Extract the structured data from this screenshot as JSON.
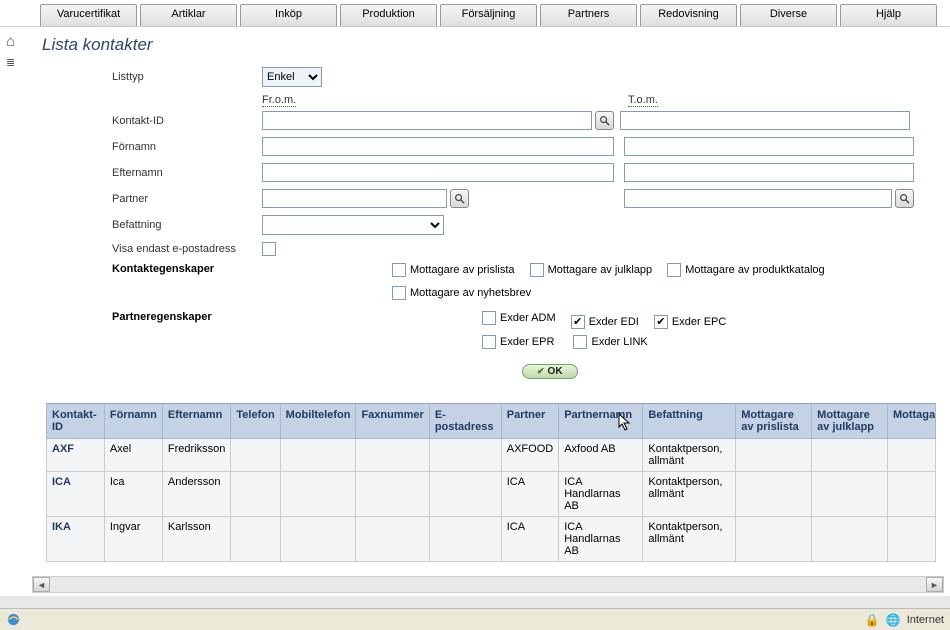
{
  "tabs": [
    "Varucertifikat",
    "Artiklar",
    "Inköp",
    "Produktion",
    "Försäljning",
    "Partners",
    "Redovisning",
    "Diverse",
    "Hjälp"
  ],
  "page_title": "Lista kontakter",
  "form": {
    "labels": {
      "listtyp": "Listtyp",
      "kontakt_id": "Kontakt-ID",
      "fornamn": "Förnamn",
      "efternamn": "Efternamn",
      "partner": "Partner",
      "befattning": "Befattning",
      "visa_epost": "Visa endast e-postadress",
      "kontaktegenskaper": "Kontaktegenskaper",
      "partneregenskaper": "Partneregenskaper"
    },
    "listtyp_value": "Enkel",
    "from_label": "Fr.o.m.",
    "tom_label": "T.o.m.",
    "kontakt_cb": [
      {
        "key": "prislista",
        "label": "Mottagare av prislista",
        "checked": false
      },
      {
        "key": "julklapp",
        "label": "Mottagare av julklapp",
        "checked": false
      },
      {
        "key": "produktkatalog",
        "label": "Mottagare av produktkatalog",
        "checked": false
      },
      {
        "key": "nyhetsbrev",
        "label": "Mottagare av nyhetsbrev",
        "checked": false
      }
    ],
    "partner_cb": [
      {
        "key": "adm",
        "label": "Exder ADM",
        "checked": false
      },
      {
        "key": "edi",
        "label": "Exder EDI",
        "checked": true
      },
      {
        "key": "epc",
        "label": "Exder EPC",
        "checked": true
      },
      {
        "key": "epr",
        "label": "Exder EPR",
        "checked": false
      },
      {
        "key": "link",
        "label": "Exder LINK",
        "checked": false
      }
    ],
    "ok_label": "OK"
  },
  "table": {
    "columns": [
      "Kontakt-ID",
      "Förnamn",
      "Efternamn",
      "Telefon",
      "Mobiltelefon",
      "Faxnummer",
      "E-postadress",
      "Partner",
      "Partnernamn",
      "Befattning",
      "Mottagare av prislista",
      "Mottagare av julklapp",
      "Mottagare produkt"
    ],
    "rows": [
      {
        "id": "AXF",
        "fornamn": "Axel",
        "efternamn": "Fredriksson",
        "telefon": "",
        "mobil": "",
        "fax": "",
        "epost": "",
        "partner": "AXFOOD",
        "partnernamn": "Axfood AB",
        "befattning": "Kontaktperson, allmänt"
      },
      {
        "id": "ICA",
        "fornamn": "Ica",
        "efternamn": "Andersson",
        "telefon": "",
        "mobil": "",
        "fax": "",
        "epost": "",
        "partner": "ICA",
        "partnernamn": "ICA Handlarnas AB",
        "befattning": "Kontaktperson, allmänt"
      },
      {
        "id": "IKA",
        "fornamn": "Ingvar",
        "efternamn": "Karlsson",
        "telefon": "",
        "mobil": "",
        "fax": "",
        "epost": "",
        "partner": "ICA",
        "partnernamn": "ICA Handlarnas AB",
        "befattning": "Kontaktperson, allmänt"
      }
    ]
  },
  "status": {
    "zone": "Internet"
  }
}
